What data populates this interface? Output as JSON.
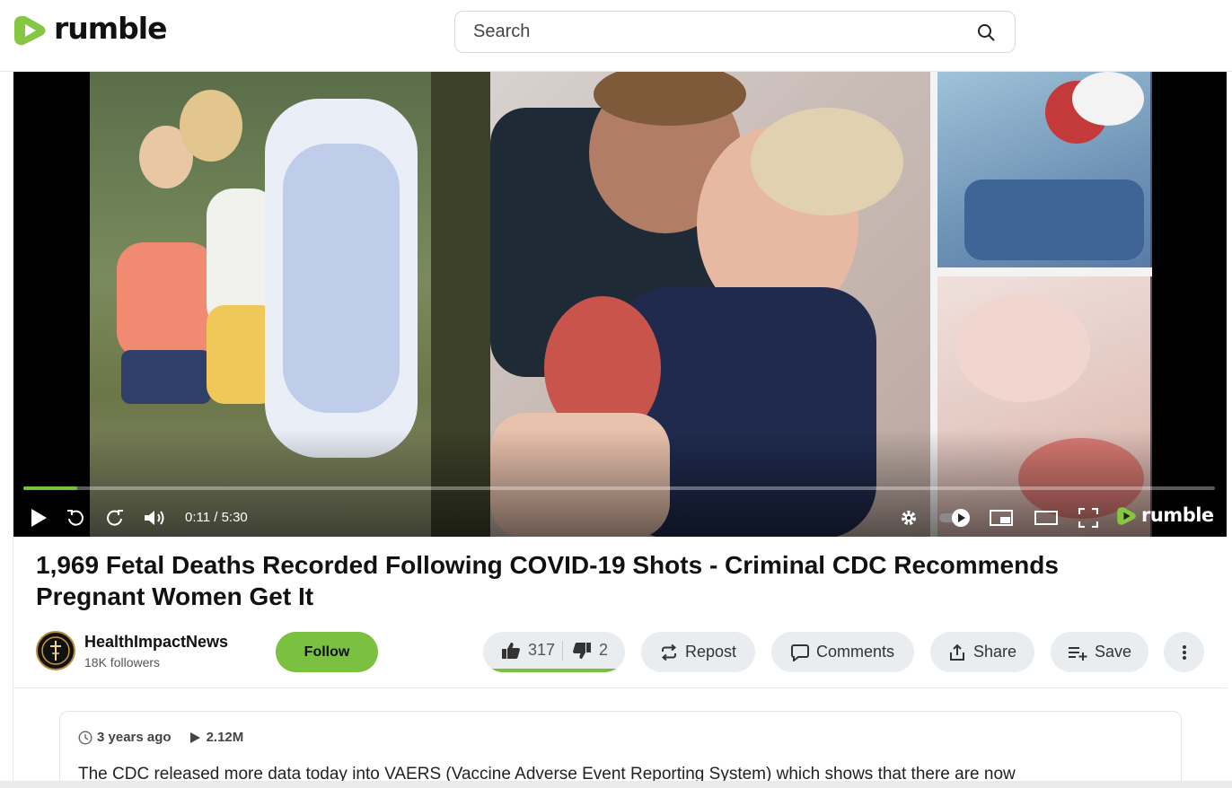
{
  "header": {
    "logo_text": "rumble",
    "search_placeholder": "Search"
  },
  "player": {
    "time_display": "0:11 / 5:30",
    "progress_fraction": 0.045,
    "logo_text": "rumble"
  },
  "video": {
    "title": "1,969 Fetal Deaths Recorded Following COVID-19 Shots - Criminal CDC Recommends Pregnant Women Get It"
  },
  "channel": {
    "name": "HealthImpactNews",
    "followers": "18K followers",
    "follow_label": "Follow"
  },
  "actions": {
    "likes": "317",
    "dislikes": "2",
    "like_ratio": 0.99,
    "repost_label": "Repost",
    "comments_label": "Comments",
    "share_label": "Share",
    "save_label": "Save"
  },
  "description": {
    "posted": "3 years ago",
    "views": "2.12M",
    "text": "The CDC released more data today into VAERS (Vaccine Adverse Event Reporting System) which shows that there are now"
  },
  "colors": {
    "accent": "#74c23b",
    "follow_button": "#7ac142",
    "pill_background": "#e9edf0"
  }
}
